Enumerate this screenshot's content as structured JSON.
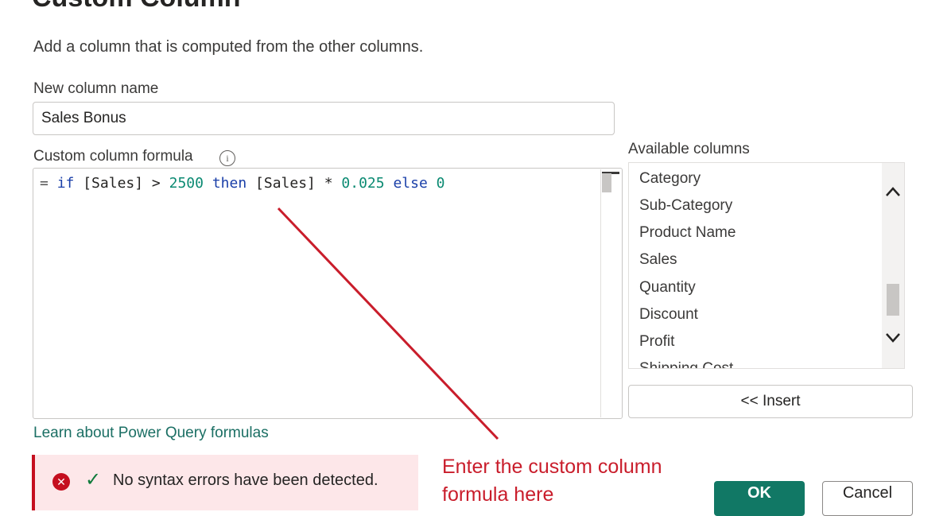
{
  "dialog": {
    "title": "Custom Column",
    "description": "Add a column that is computed from the other columns."
  },
  "new_column": {
    "label": "New column name",
    "value": "Sales Bonus"
  },
  "formula": {
    "label": "Custom column formula",
    "info_icon": "info-icon",
    "tokens": {
      "eq": "=",
      "if": "if",
      "field1": "[Sales]",
      "gt": ">",
      "n1": "2500",
      "then": "then",
      "field2": "[Sales]",
      "mul": "*",
      "n2": "0.025",
      "else": "else",
      "n3": "0"
    }
  },
  "available_columns": {
    "label": "Available columns",
    "items": [
      "Category",
      "Sub-Category",
      "Product Name",
      "Sales",
      "Quantity",
      "Discount",
      "Profit",
      "Shipping Cost"
    ],
    "scroll_up_icon": "chevron-up-icon",
    "scroll_down_icon": "chevron-down-icon"
  },
  "insert_button": "<< Insert",
  "learn_link": "Learn about Power Query formulas",
  "status": {
    "text": "No syntax errors have been detected.",
    "error_icon": "error-circle-icon",
    "check_icon": "checkmark-icon"
  },
  "annotation": {
    "line1": "Enter the custom column",
    "line2": "formula here",
    "color": "#c91d2b"
  },
  "buttons": {
    "ok": "OK",
    "cancel": "Cancel"
  },
  "colors": {
    "accent": "#117865",
    "error": "#c50f1f",
    "link": "#1b6f64"
  }
}
